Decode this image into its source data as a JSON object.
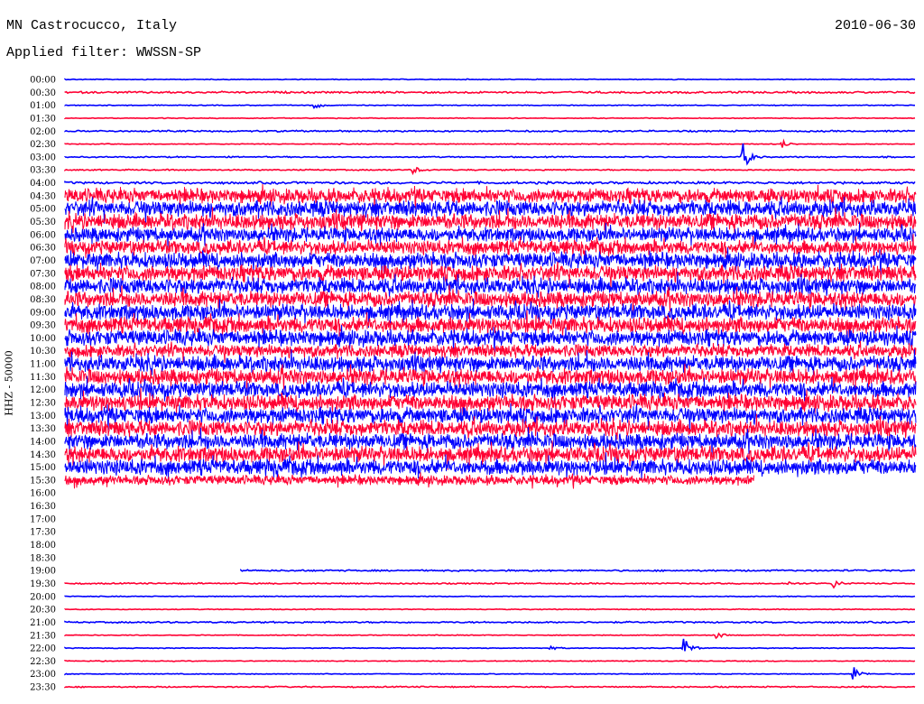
{
  "header": {
    "station": "MN Castrocucco, Italy",
    "date": "2010-06-30",
    "filter": "Applied filter: WWSSN-SP"
  },
  "chart_data": {
    "type": "line",
    "title": "MN Castrocucco, Italy",
    "ylabel": "HHZ - 50000",
    "row_minutes": 30,
    "colors": {
      "even": "#0000ff",
      "odd": "#ff0033"
    },
    "rows": [
      {
        "label": "00:00",
        "amp": 0.5
      },
      {
        "label": "00:30",
        "amp": 1.2
      },
      {
        "label": "01:00",
        "amp": 0.5,
        "events": [
          {
            "min": 8.8,
            "amp": 4
          }
        ]
      },
      {
        "label": "01:30",
        "amp": 0.5
      },
      {
        "label": "02:00",
        "amp": 1
      },
      {
        "label": "02:30",
        "amp": 0.5,
        "events": [
          {
            "min": 25.3,
            "amp": 4
          }
        ]
      },
      {
        "label": "03:00",
        "amp": 0.8,
        "events": [
          {
            "min": 23.9,
            "amp": 16
          }
        ]
      },
      {
        "label": "03:30",
        "amp": 0.8,
        "events": [
          {
            "min": 12.3,
            "amp": 4
          }
        ]
      },
      {
        "label": "04:00",
        "amp": 1.5
      },
      {
        "label": "04:30",
        "amp": 9
      },
      {
        "label": "05:00",
        "amp": 10
      },
      {
        "label": "05:30",
        "amp": 10
      },
      {
        "label": "06:00",
        "amp": 9
      },
      {
        "label": "06:30",
        "amp": 9
      },
      {
        "label": "07:00",
        "amp": 10
      },
      {
        "label": "07:30",
        "amp": 10
      },
      {
        "label": "08:00",
        "amp": 10
      },
      {
        "label": "08:30",
        "amp": 10
      },
      {
        "label": "09:00",
        "amp": 10
      },
      {
        "label": "09:30",
        "amp": 10
      },
      {
        "label": "10:00",
        "amp": 10
      },
      {
        "label": "10:30",
        "amp": 8
      },
      {
        "label": "11:00",
        "amp": 10
      },
      {
        "label": "11:30",
        "amp": 10
      },
      {
        "label": "12:00",
        "amp": 10
      },
      {
        "label": "12:30",
        "amp": 10
      },
      {
        "label": "13:00",
        "amp": 10
      },
      {
        "label": "13:30",
        "amp": 10
      },
      {
        "label": "14:00",
        "amp": 10
      },
      {
        "label": "14:30",
        "amp": 10
      },
      {
        "label": "15:00",
        "amp": 10
      },
      {
        "label": "15:30",
        "amp": 6,
        "end_min": 24.3
      },
      {
        "label": "16:00",
        "amp": 0,
        "nodata": true
      },
      {
        "label": "16:30",
        "amp": 0,
        "nodata": true
      },
      {
        "label": "17:00",
        "amp": 0,
        "nodata": true
      },
      {
        "label": "17:30",
        "amp": 0,
        "nodata": true
      },
      {
        "label": "18:00",
        "amp": 0,
        "nodata": true
      },
      {
        "label": "18:30",
        "amp": 0,
        "nodata": true
      },
      {
        "label": "19:00",
        "amp": 1,
        "start_min": 6.2
      },
      {
        "label": "19:30",
        "amp": 0.8,
        "events": [
          {
            "min": 27.1,
            "amp": 5
          },
          {
            "min": 25.5,
            "amp": 2
          }
        ]
      },
      {
        "label": "20:00",
        "amp": 0.5
      },
      {
        "label": "20:30",
        "amp": 0.5
      },
      {
        "label": "21:00",
        "amp": 1
      },
      {
        "label": "21:30",
        "amp": 0.5,
        "events": [
          {
            "min": 23.0,
            "amp": 4
          }
        ]
      },
      {
        "label": "22:00",
        "amp": 0.5,
        "events": [
          {
            "min": 21.8,
            "amp": 14
          },
          {
            "min": 17.1,
            "amp": 2
          }
        ]
      },
      {
        "label": "22:30",
        "amp": 0.5
      },
      {
        "label": "23:00",
        "amp": 0.5,
        "events": [
          {
            "min": 27.8,
            "amp": 9
          }
        ]
      },
      {
        "label": "23:30",
        "amp": 0.8
      }
    ]
  }
}
